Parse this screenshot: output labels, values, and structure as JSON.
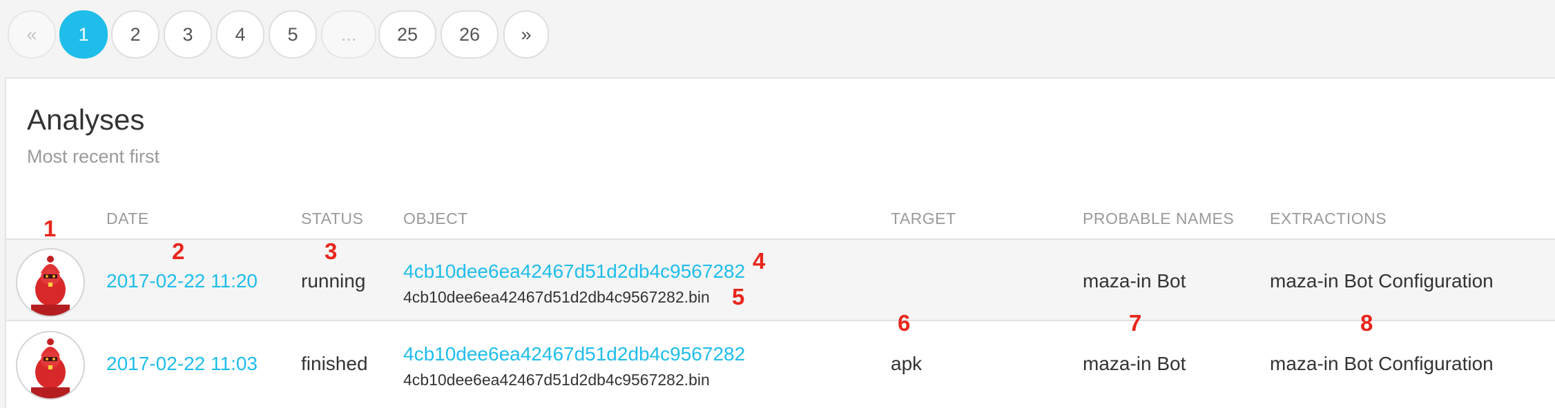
{
  "pagination": {
    "items": [
      {
        "label": "«",
        "state": "disabled"
      },
      {
        "label": "1",
        "state": "active"
      },
      {
        "label": "2",
        "state": "normal"
      },
      {
        "label": "3",
        "state": "normal"
      },
      {
        "label": "4",
        "state": "normal"
      },
      {
        "label": "5",
        "state": "normal"
      },
      {
        "label": "...",
        "state": "disabled"
      },
      {
        "label": "25",
        "state": "normal"
      },
      {
        "label": "26",
        "state": "normal"
      },
      {
        "label": "»",
        "state": "normal"
      }
    ]
  },
  "card": {
    "title": "Analyses",
    "subtitle": "Most recent first"
  },
  "table": {
    "headers": {
      "date": "DATE",
      "status": "STATUS",
      "object": "OBJECT",
      "target": "TARGET",
      "probable_names": "PROBABLE NAMES",
      "extractions": "EXTRACTIONS"
    },
    "rows": [
      {
        "date": "2017-02-22 11:20",
        "status": "running",
        "object_hash": "4cb10dee6ea42467d51d2db4c9567282",
        "object_file": "4cb10dee6ea42467d51d2db4c9567282.bin",
        "target": "",
        "probable_names": "maza-in Bot",
        "extractions": "maza-in Bot Configuration"
      },
      {
        "date": "2017-02-22 11:03",
        "status": "finished",
        "object_hash": "4cb10dee6ea42467d51d2db4c9567282",
        "object_file": "4cb10dee6ea42467d51d2db4c9567282.bin",
        "target": "apk",
        "probable_names": "maza-in Bot",
        "extractions": "maza-in Bot Configuration"
      }
    ]
  },
  "annotations": [
    "1",
    "2",
    "3",
    "4",
    "5",
    "6",
    "7",
    "8"
  ],
  "colors": {
    "accent": "#1fbdea",
    "annotation": "#e8261c",
    "muted": "#9a9a9a"
  }
}
